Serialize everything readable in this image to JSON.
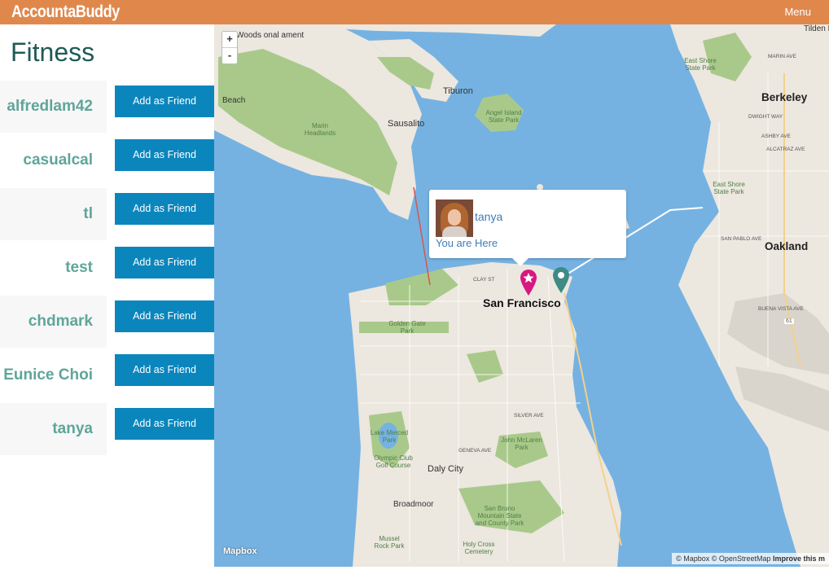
{
  "app": {
    "brand": "AccountaBuddy",
    "menu_label": "Menu"
  },
  "page": {
    "title": "Fitness"
  },
  "users": [
    {
      "name": "alfredlam42",
      "button": "Add as Friend"
    },
    {
      "name": "casualcal",
      "button": "Add as Friend"
    },
    {
      "name": "tl",
      "button": "Add as Friend"
    },
    {
      "name": "test",
      "button": "Add as Friend"
    },
    {
      "name": "chdmark",
      "button": "Add as Friend"
    },
    {
      "name": "Eunice Choi",
      "button": "Add as Friend"
    },
    {
      "name": "tanya",
      "button": "Add as Friend"
    }
  ],
  "map": {
    "zoom_in": "+",
    "zoom_out": "-",
    "logo": "Mapbox",
    "attribution_prefix": "© Mapbox © OpenStreetMap",
    "attribution_link": "Improve this m",
    "popup": {
      "name": "tanya",
      "subtitle": "You are Here"
    },
    "labels": {
      "sf": "San Francisco",
      "oakland": "Oakland",
      "berkeley": "Berkeley",
      "sausalito": "Sausalito",
      "tiburon": "Tiburon",
      "daly_city": "Daly City",
      "broadmoor": "Broadmoor",
      "marin_headlands": "Marin Headlands",
      "angel_island": "Angel Island State Park",
      "golden_gate_park": "Golden Gate Park",
      "lake_merced": "Lake Merced Park",
      "olympic_club": "Olympic Club Golf Course",
      "john_mclaren": "John McLaren Park",
      "san_bruno": "San Bruno Mountain State and County Park",
      "holy_cross": "Holy Cross Cemetery",
      "mussel_rock": "Mussel Rock Park",
      "east_shore_1": "East Shore State Park",
      "east_shore_2": "East Shore State Park",
      "beach": "Beach",
      "woods": "Woods onal ament",
      "tilden": "Tilden P",
      "clay_st": "CLAY ST",
      "silver_ave": "SILVER AVE",
      "geneva_ave": "GENEVA AVE",
      "buena_vista": "BUENA VISTA AVE",
      "san_pablo": "SAN PABLO AVE",
      "dwight_way": "DWIGHT WAY",
      "ashby_ave": "ASHBY AVE",
      "alcatraz_ave": "ALCATRAZ AVE",
      "marin_ave": "MARIN AVE",
      "route_61": "61"
    },
    "colors": {
      "water": "#75b2e2",
      "land": "#ece7df",
      "park": "#a9c98b",
      "marker_user": "#d6197f",
      "marker_other": "#3d8b84"
    }
  },
  "colors": {
    "topbar": "#e0884c",
    "button": "#0b86bd",
    "user_name": "#5fa59a",
    "title": "#1f5a57"
  }
}
